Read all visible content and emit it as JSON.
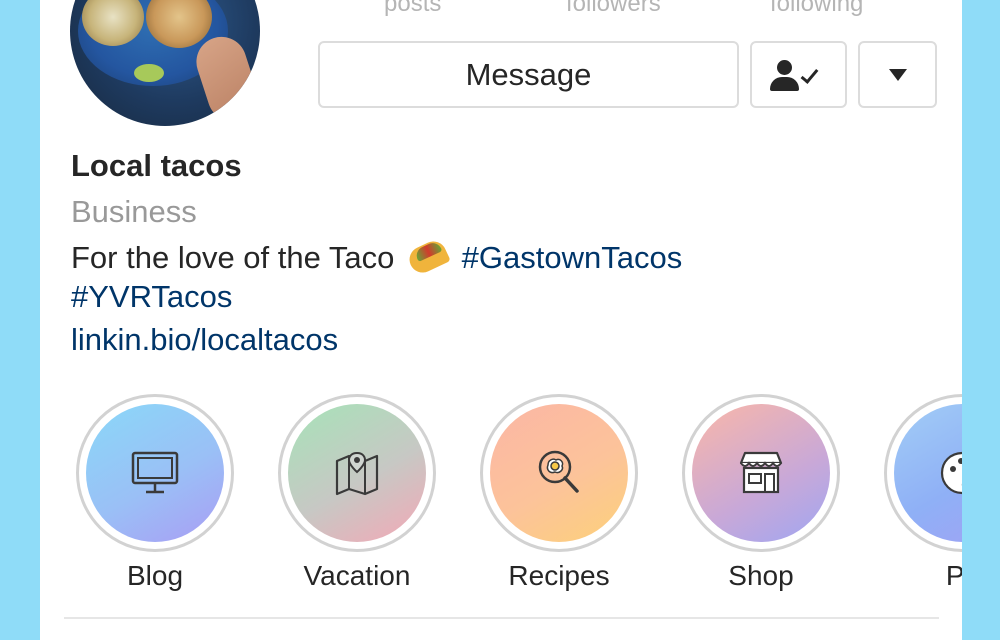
{
  "profile": {
    "stats": [
      "posts",
      "followers",
      "following"
    ],
    "message_label": "Message",
    "name": "Local tacos",
    "category": "Business",
    "bio_text": "For the love of the Taco",
    "bio_hashtag_1": "#GastownTacos",
    "bio_hashtag_2": "#YVRTacos",
    "link": "linkin.bio/localtacos"
  },
  "highlights": [
    {
      "label": "Blog",
      "icon": "monitor-icon"
    },
    {
      "label": "Vacation",
      "icon": "map-icon"
    },
    {
      "label": "Recipes",
      "icon": "frying-pan-icon"
    },
    {
      "label": "Shop",
      "icon": "storefront-icon"
    },
    {
      "label": "Pri",
      "icon": "palette-icon"
    }
  ],
  "colors": {
    "background": "#8fdcf8",
    "link": "#003569",
    "text": "#262626",
    "muted": "#999999"
  }
}
